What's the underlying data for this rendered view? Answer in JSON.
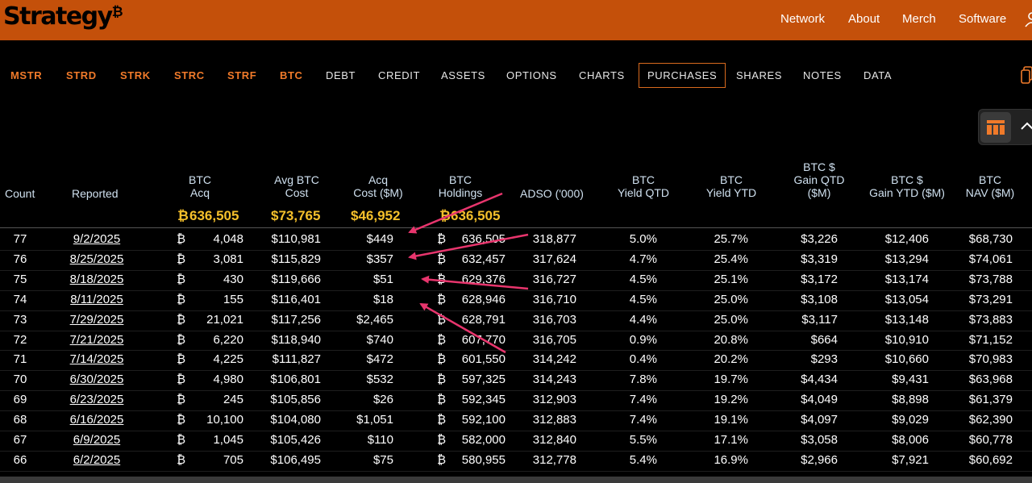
{
  "header": {
    "logo_text": "Strategy",
    "logo_mark": "₿",
    "nav": [
      "Network",
      "About",
      "Merch",
      "Software"
    ]
  },
  "tabs": [
    "MSTR",
    "STRD",
    "STRK",
    "STRC",
    "STRF",
    "BTC",
    "DEBT",
    "CREDIT",
    "ASSETS",
    "OPTIONS",
    "CHARTS",
    "PURCHASES",
    "SHARES",
    "NOTES",
    "DATA"
  ],
  "active_tab": "PURCHASES",
  "colors": {
    "header": "#c4500a",
    "accent": "#f07a2a",
    "totals": "#f5c02b",
    "annotation_arrow": "#e8356d"
  },
  "table": {
    "headers": {
      "count": "Count",
      "reported": "Reported",
      "btc_acq": [
        "BTC",
        "Acq"
      ],
      "avg_cost": [
        "Avg BTC",
        "Cost"
      ],
      "acq_cost": [
        "Acq",
        "Cost ($M)"
      ],
      "holdings": [
        "BTC",
        "Holdings"
      ],
      "adso": "ADSO ('000)",
      "yield_qtd": [
        "BTC",
        "Yield QTD"
      ],
      "yield_ytd": [
        "BTC",
        "Yield YTD"
      ],
      "gain_qtd": [
        "BTC $",
        "Gain QTD",
        "($M)"
      ],
      "gain_ytd": [
        "BTC $",
        "Gain YTD ($M)"
      ],
      "nav": [
        "BTC",
        "NAV ($M)"
      ]
    },
    "totals": {
      "btc_symbol": "₿",
      "btc_acq": "636,505",
      "avg_cost": "$73,765",
      "acq_cost": "$46,952",
      "holdings": "636,505"
    },
    "rows": [
      {
        "count": "77",
        "date": "9/2/2025",
        "acq": "4,048",
        "avg": "$110,981",
        "cost": "$449",
        "hold": "636,505",
        "adso": "318,877",
        "yq": "5.0%",
        "yy": "25.7%",
        "gq": "$3,226",
        "gy": "$12,406",
        "nav": "$68,730"
      },
      {
        "count": "76",
        "date": "8/25/2025",
        "acq": "3,081",
        "avg": "$115,829",
        "cost": "$357",
        "hold": "632,457",
        "adso": "317,624",
        "yq": "4.7%",
        "yy": "25.4%",
        "gq": "$3,319",
        "gy": "$13,294",
        "nav": "$74,061"
      },
      {
        "count": "75",
        "date": "8/18/2025",
        "acq": "430",
        "avg": "$119,666",
        "cost": "$51",
        "hold": "629,376",
        "adso": "316,727",
        "yq": "4.5%",
        "yy": "25.1%",
        "gq": "$3,172",
        "gy": "$13,174",
        "nav": "$73,788"
      },
      {
        "count": "74",
        "date": "8/11/2025",
        "acq": "155",
        "avg": "$116,401",
        "cost": "$18",
        "hold": "628,946",
        "adso": "316,710",
        "yq": "4.5%",
        "yy": "25.0%",
        "gq": "$3,108",
        "gy": "$13,054",
        "nav": "$73,291"
      },
      {
        "count": "73",
        "date": "7/29/2025",
        "acq": "21,021",
        "avg": "$117,256",
        "cost": "$2,465",
        "hold": "628,791",
        "adso": "316,703",
        "yq": "4.4%",
        "yy": "25.0%",
        "gq": "$3,117",
        "gy": "$13,148",
        "nav": "$73,883"
      },
      {
        "count": "72",
        "date": "7/21/2025",
        "acq": "6,220",
        "avg": "$118,940",
        "cost": "$740",
        "hold": "607,770",
        "adso": "316,705",
        "yq": "0.9%",
        "yy": "20.8%",
        "gq": "$664",
        "gy": "$10,910",
        "nav": "$71,152"
      },
      {
        "count": "71",
        "date": "7/14/2025",
        "acq": "4,225",
        "avg": "$111,827",
        "cost": "$472",
        "hold": "601,550",
        "adso": "314,242",
        "yq": "0.4%",
        "yy": "20.2%",
        "gq": "$293",
        "gy": "$10,660",
        "nav": "$70,983"
      },
      {
        "count": "70",
        "date": "6/30/2025",
        "acq": "4,980",
        "avg": "$106,801",
        "cost": "$532",
        "hold": "597,325",
        "adso": "314,243",
        "yq": "7.8%",
        "yy": "19.7%",
        "gq": "$4,434",
        "gy": "$9,431",
        "nav": "$63,968"
      },
      {
        "count": "69",
        "date": "6/23/2025",
        "acq": "245",
        "avg": "$105,856",
        "cost": "$26",
        "hold": "592,345",
        "adso": "312,903",
        "yq": "7.4%",
        "yy": "19.2%",
        "gq": "$4,049",
        "gy": "$8,898",
        "nav": "$61,379"
      },
      {
        "count": "68",
        "date": "6/16/2025",
        "acq": "10,100",
        "avg": "$104,080",
        "cost": "$1,051",
        "hold": "592,100",
        "adso": "312,883",
        "yq": "7.4%",
        "yy": "19.1%",
        "gq": "$4,097",
        "gy": "$9,029",
        "nav": "$62,390"
      },
      {
        "count": "67",
        "date": "6/9/2025",
        "acq": "1,045",
        "avg": "$105,426",
        "cost": "$110",
        "hold": "582,000",
        "adso": "312,840",
        "yq": "5.5%",
        "yy": "17.1%",
        "gq": "$3,058",
        "gy": "$8,006",
        "nav": "$60,778"
      },
      {
        "count": "66",
        "date": "6/2/2025",
        "acq": "705",
        "avg": "$106,495",
        "cost": "$75",
        "hold": "580,955",
        "adso": "312,778",
        "yq": "5.4%",
        "yy": "16.9%",
        "gq": "$2,966",
        "gy": "$7,921",
        "nav": "$60,692"
      }
    ]
  }
}
